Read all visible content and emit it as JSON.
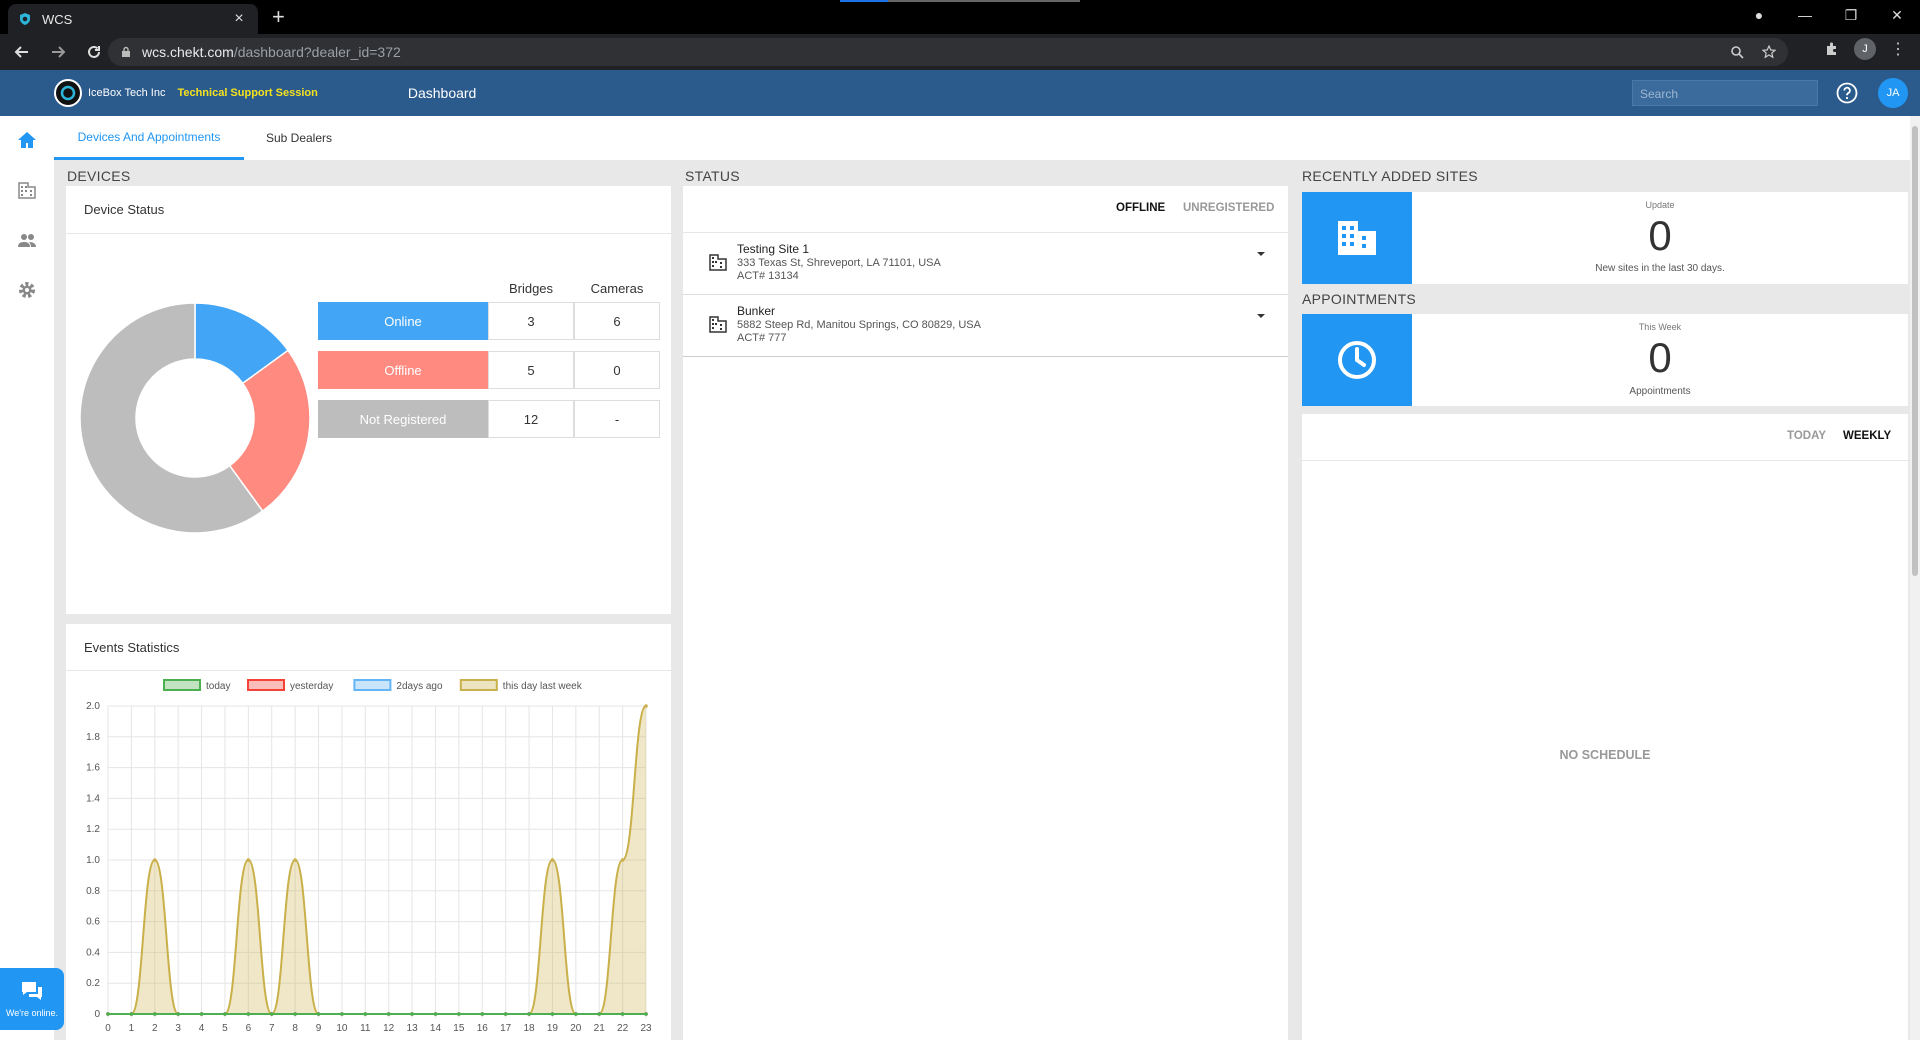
{
  "browser": {
    "tab_title": "WCS",
    "url_host": "wcs.chekt.com",
    "url_path": "/dashboard?dealer_id=372",
    "profile_initial": "J"
  },
  "header": {
    "company": "IceBox Tech Inc",
    "session": "Technical Support Session",
    "title": "Dashboard",
    "search_placeholder": "Search",
    "user_initials": "JA"
  },
  "tabs": [
    "Devices And Appointments",
    "Sub Dealers"
  ],
  "devices": {
    "section": "DEVICES",
    "card_title": "Device Status",
    "col_bridges": "Bridges",
    "col_cameras": "Cameras",
    "rows": [
      {
        "label": "Online",
        "bridges": "3",
        "cameras": "6",
        "color": "#42a5f5"
      },
      {
        "label": "Offline",
        "bridges": "5",
        "cameras": "0",
        "color": "#ff8a80"
      },
      {
        "label": "Not Registered",
        "bridges": "12",
        "cameras": "-",
        "color": "#bdbdbd"
      }
    ]
  },
  "events": {
    "card_title": "Events Statistics"
  },
  "chart_data": {
    "type": "line",
    "x": [
      0,
      1,
      2,
      3,
      4,
      5,
      6,
      7,
      8,
      9,
      10,
      11,
      12,
      13,
      14,
      15,
      16,
      17,
      18,
      19,
      20,
      21,
      22,
      23
    ],
    "ylim": [
      0,
      2.0
    ],
    "yticks": [
      "0",
      "0.2",
      "0.4",
      "0.6",
      "0.8",
      "1.0",
      "1.2",
      "1.4",
      "1.6",
      "1.8",
      "2.0"
    ],
    "legend": "top",
    "series": [
      {
        "name": "today",
        "color": "#4caf50",
        "values": [
          0,
          0,
          0,
          0,
          0,
          0,
          0,
          0,
          0,
          0,
          0,
          0,
          0,
          0,
          0,
          0,
          0,
          0,
          0,
          0,
          0,
          0,
          0,
          0
        ]
      },
      {
        "name": "yesterday",
        "color": "#f44336",
        "values": [
          0,
          0,
          0,
          0,
          0,
          0,
          0,
          0,
          0,
          0,
          0,
          0,
          0,
          0,
          0,
          0,
          0,
          0,
          0,
          0,
          0,
          0,
          0,
          0
        ]
      },
      {
        "name": "2days ago",
        "color": "#64b5f6",
        "values": [
          0,
          0,
          0,
          0,
          0,
          0,
          0,
          0,
          0,
          0,
          0,
          0,
          0,
          0,
          0,
          0,
          0,
          0,
          0,
          0,
          0,
          0,
          0,
          0
        ]
      },
      {
        "name": "this day last week",
        "color": "#c9b04a",
        "values": [
          0,
          0,
          1,
          0,
          0,
          0,
          1,
          0,
          1,
          0,
          0,
          0,
          0,
          0,
          0,
          0,
          0,
          0,
          0,
          1,
          0,
          0,
          1,
          2
        ]
      }
    ]
  },
  "status": {
    "section": "STATUS",
    "tab_offline": "OFFLINE",
    "tab_unregistered": "UNREGISTERED",
    "sites": [
      {
        "name": "Testing Site 1",
        "address": "333 Texas St, Shreveport, LA 71101, USA",
        "act": "ACT# 13134"
      },
      {
        "name": "Bunker",
        "address": "5882 Steep Rd, Manitou Springs, CO 80829, USA",
        "act": "ACT# 777"
      }
    ]
  },
  "recent": {
    "section": "RECENTLY ADDED SITES",
    "label": "Update",
    "count": "0",
    "sub": "New sites in the last 30 days."
  },
  "appointments": {
    "section": "APPOINTMENTS",
    "label": "This Week",
    "count": "0",
    "sub": "Appointments"
  },
  "schedule": {
    "tab_today": "TODAY",
    "tab_weekly": "WEEKLY",
    "empty": "NO SCHEDULE"
  },
  "chat": {
    "label": "We're online."
  }
}
